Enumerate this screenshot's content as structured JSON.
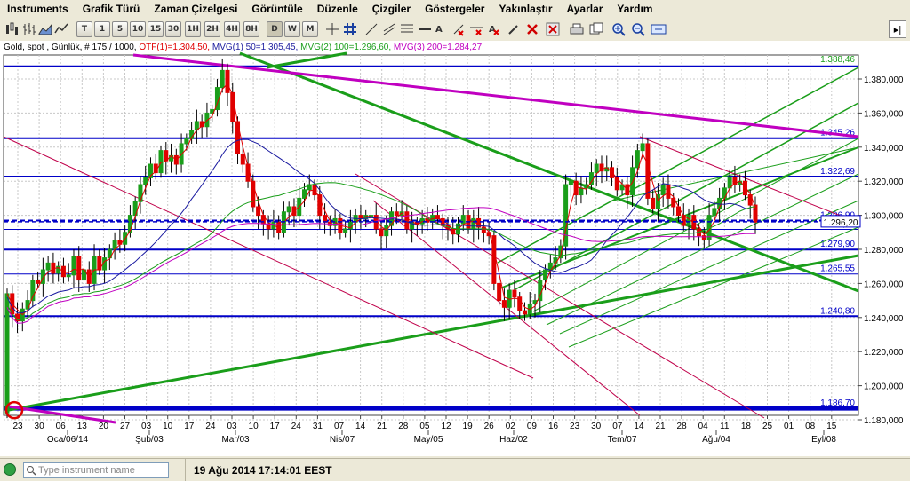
{
  "menu": [
    "Instruments",
    "Grafik Türü",
    "Zaman Çizelgesi",
    "Görüntüle",
    "Düzenle",
    "Çizgiler",
    "Göstergeler",
    "Yakınlaştır",
    "Ayarlar",
    "Yardım"
  ],
  "timeframes": [
    "T",
    "1",
    "5",
    "10",
    "15",
    "30",
    "1H",
    "2H",
    "4H",
    "8H",
    "D",
    "W",
    "M"
  ],
  "selected_timeframe": "D",
  "legend": {
    "instrument": "Gold, spot , Günlük, # 175 / 1000,",
    "otf": "OTF(1)=1.304,50,",
    "mvg1": "MVG(1) 50=1.305,45,",
    "mvg2": "MVG(2) 100=1.296,60,",
    "mvg3": "MVG(3) 200=1.284,27"
  },
  "y_axis": {
    "labels": [
      "1.380,000",
      "1.360,000",
      "1.340,000",
      "1.320,000",
      "1.300,000",
      "1.280,000",
      "1.260,000",
      "1.240,000",
      "1.220,000",
      "1.200,000",
      "1.180,000"
    ]
  },
  "x_axis": {
    "days": [
      "23",
      "30",
      "06",
      "13",
      "20",
      "27",
      "03",
      "10",
      "17",
      "24",
      "03",
      "10",
      "17",
      "24",
      "31",
      "07",
      "14",
      "21",
      "28",
      "05",
      "12",
      "19",
      "26",
      "02",
      "09",
      "16",
      "23",
      "30",
      "07",
      "14",
      "21",
      "28",
      "04",
      "11",
      "18",
      "25",
      "01",
      "08",
      "15"
    ],
    "months": [
      "Oca/06/14",
      "Şub/03",
      "Mar/03",
      "Nis/07",
      "May/05",
      "Haz/02",
      "Tem/07",
      "Ağu/04",
      "Eyl/08"
    ]
  },
  "levels": [
    {
      "label": "1.388,46",
      "color": "#1a9e1a"
    },
    {
      "label": "1.345,26",
      "color": "#0000c8"
    },
    {
      "label": "1.322,69",
      "color": "#0000c8"
    },
    {
      "label": "1.296,90",
      "color": "#0000c8"
    },
    {
      "label": "1.291,70",
      "color": "#0000c8"
    },
    {
      "label": "1.279,90",
      "color": "#0000c8"
    },
    {
      "label": "1.265,55",
      "color": "#0000c8"
    },
    {
      "label": "1.240,80",
      "color": "#0000c8"
    },
    {
      "label": "1.186,70",
      "color": "#0000c8"
    }
  ],
  "current_price": "1.296,20",
  "status": {
    "search_placeholder": "Type instrument name",
    "datetime": "19 Ağu 2014 17:14:01 EEST"
  },
  "colors": {
    "up": "#1a9e1a",
    "down": "#e00000",
    "hline": "#0000c8",
    "purple": "#c000c0",
    "ma": "#1a1aa0"
  }
}
